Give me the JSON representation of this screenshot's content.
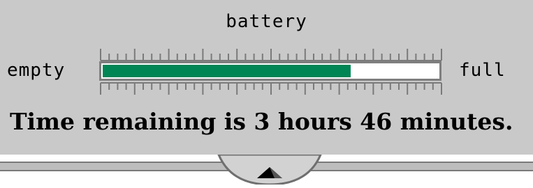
{
  "battery": {
    "title": "battery",
    "empty_label": "empty",
    "full_label": "full",
    "level_fraction": 0.74,
    "status_text": "Time remaining is 3 hours 46 minutes.",
    "colors": {
      "panel_bg": "#c9c9c9",
      "fill": "#008555",
      "meter_bg": "#ffffff"
    }
  },
  "handle": {
    "icon": "triangle-up-icon"
  }
}
